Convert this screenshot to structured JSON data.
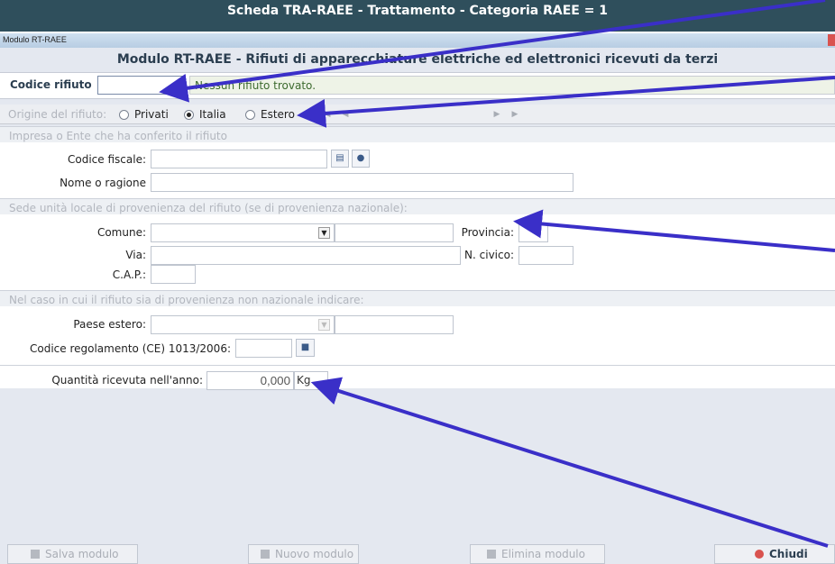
{
  "app_title": "Scheda TRA-RAEE - Trattamento - Categoria RAEE = 1",
  "window_title": "Modulo RT-RAEE",
  "form_title": "Modulo RT-RAEE - Rifiuti di apparecchiature elettriche ed elettronici ricevuti da terzi",
  "codice": {
    "label": "Codice rifiuto",
    "value": "",
    "status": "Nessun rifiuto trovato."
  },
  "origin": {
    "label": "Origine del rifiuto:",
    "options": [
      "Privati",
      "Italia",
      "Estero"
    ],
    "selected": "Italia"
  },
  "impresa": {
    "section": "Impresa o Ente che ha conferito il rifiuto",
    "cf_label": "Codice fiscale:",
    "cf_value": "",
    "nome_label": "Nome o ragione",
    "nome_value": ""
  },
  "sede": {
    "section": "Sede unità locale di provenienza del rifiuto (se di provenienza nazionale):",
    "comune_label": "Comune:",
    "provincia_label": "Provincia:",
    "via_label": "Via:",
    "civico_label": "N. civico:",
    "cap_label": "C.A.P.:"
  },
  "estero": {
    "section": "Nel caso in cui il rifiuto sia di provenienza non nazionale indicare:",
    "paese_label": "Paese estero:",
    "regolamento_label": "Codice regolamento (CE) 1013/2006:"
  },
  "quantita": {
    "label": "Quantità ricevuta nell'anno:",
    "value": "0,000",
    "unit": "Kg"
  },
  "footer": {
    "salva": "Salva modulo",
    "nuovo": "Nuovo modulo",
    "elimina": "Elimina modulo",
    "chiudi": "Chiudi"
  },
  "colors": {
    "accent": "#2b3e50",
    "arrow": "#3a2fc8",
    "close": "#d9534f"
  }
}
